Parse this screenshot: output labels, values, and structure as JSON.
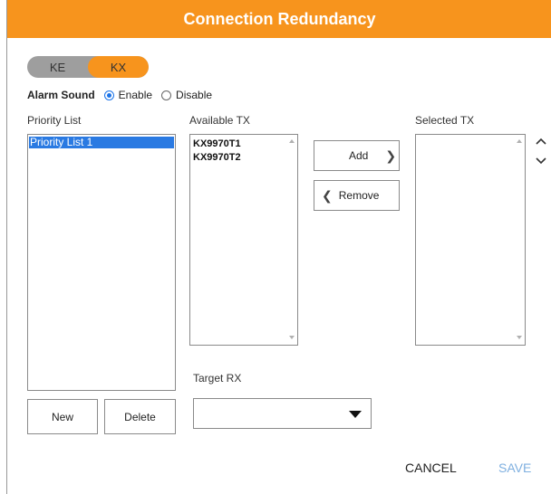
{
  "dialog": {
    "title": "Connection Redundancy",
    "accent_color": "#f7941d"
  },
  "toggle": {
    "left_label": "KE",
    "right_label": "KX",
    "selected": "KX"
  },
  "alarm": {
    "label": "Alarm Sound",
    "enable_label": "Enable",
    "disable_label": "Disable",
    "selected": "Enable"
  },
  "priority": {
    "label": "Priority List",
    "items": [
      "Priority List 1"
    ],
    "new_label": "New",
    "delete_label": "Delete"
  },
  "available": {
    "label": "Available TX",
    "items": [
      "KX9970T1",
      "KX9970T2"
    ]
  },
  "selected": {
    "label": "Selected TX",
    "items": []
  },
  "actions": {
    "add_label": "Add",
    "remove_label": "Remove"
  },
  "target": {
    "label": "Target RX",
    "value": ""
  },
  "footer": {
    "cancel_label": "CANCEL",
    "save_label": "SAVE",
    "save_color": "#7fb0e0"
  },
  "icons": [
    "chevron-up-icon",
    "chevron-down-icon",
    "chevron-right-icon",
    "chevron-left-icon",
    "dropdown-arrow-icon"
  ]
}
